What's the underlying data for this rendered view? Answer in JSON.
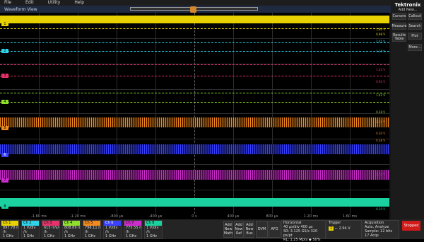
{
  "menu": [
    "File",
    "Edit",
    "Utility",
    "Help"
  ],
  "window_title": "Waveform View",
  "brand": {
    "name": "Tektronix",
    "sub": "Add New..."
  },
  "right_buttons": [
    {
      "label": "Cursors"
    },
    {
      "label": "Callout"
    },
    {
      "label": "Measure"
    },
    {
      "label": "Search"
    },
    {
      "label": "Results Table"
    },
    {
      "label": "Plot"
    },
    {
      "label": "More..."
    }
  ],
  "channels": [
    {
      "id": "1",
      "color": "#e8d100",
      "right": [
        "1.80 V",
        "0.98 V"
      ]
    },
    {
      "id": "2",
      "color": "#2fd3e8",
      "right": [
        "2.45 V",
        "1.14 V"
      ]
    },
    {
      "id": "3",
      "color": "#e4336b",
      "right": [
        "1.63 V",
        "0.90 V"
      ]
    },
    {
      "id": "4",
      "color": "#8ee02a",
      "right": [
        "1.42 V",
        "0.28 V"
      ]
    },
    {
      "id": "5",
      "color": "#f08a1e",
      "right": [
        "1.50 V",
        "0.30 V"
      ]
    },
    {
      "id": "6",
      "color": "#3a42ff",
      "right": [
        "",
        "0.38 V"
      ]
    },
    {
      "id": "7",
      "color": "#cc2ccc",
      "right": [
        "1.56 V",
        ""
      ]
    },
    {
      "id": "8",
      "color": "#1bd1a0",
      "right": [
        "",
        "0.10 V"
      ]
    }
  ],
  "x_ticks": [
    "-1.60 ms",
    "-1.20 ms",
    "-800 µs",
    "-400 µs",
    "0 s",
    "400 µs",
    "800 µs",
    "1.20 ms",
    "1.60 ms"
  ],
  "bottom_channels": [
    {
      "name": "Ch 1",
      "v1": "897.78 m...",
      "v2": "/h",
      "v3": "1 GHz"
    },
    {
      "name": "Ch 2",
      "v1": "1 V/div",
      "v2": "/h",
      "v3": "1 GHz"
    },
    {
      "name": "Ch 3",
      "v1": "615 mV/div",
      "v2": "/h",
      "v3": "1 GHz"
    },
    {
      "name": "Ch 4",
      "v1": "808.89 m...",
      "v2": "/h",
      "v3": "1 GHz"
    },
    {
      "name": "Ch 5",
      "v1": "796.11 m...",
      "v2": "/h",
      "v3": "1 GHz"
    },
    {
      "name": "Ch 6",
      "v1": "1 V/div",
      "v2": "/h",
      "v3": "1 GHz"
    },
    {
      "name": "Ch 7",
      "v1": "775.55 m...",
      "v2": "/h",
      "v3": "1 GHz"
    },
    {
      "name": "Ch 8",
      "v1": "1 V/div",
      "v2": "/h",
      "v3": "1 GHz"
    }
  ],
  "add_buttons": [
    {
      "l1": "Add",
      "l2": "New",
      "l3": "Math"
    },
    {
      "l1": "Add",
      "l2": "New",
      "l3": "Ref"
    },
    {
      "l1": "Add",
      "l2": "New",
      "l3": "Bus"
    }
  ],
  "dvm": "DVM",
  "afg": "AFG",
  "horizontal": {
    "title": "Horizontal",
    "l1": "40 µs/div   400 µs",
    "l2": "SR: 3.125 GS/s  320 ps/pt",
    "l3": "RL: 1.25 Mpts  ◆ 50%"
  },
  "trigger": {
    "title": "Trigger",
    "ch": "1",
    "val": "2.94 V"
  },
  "acquisition": {
    "title": "Acquisition",
    "l1": "Auto,     Analyze",
    "l2": "Sample: 12 bits",
    "l3": "17 Acqs"
  },
  "stop_label": "Stopped"
}
